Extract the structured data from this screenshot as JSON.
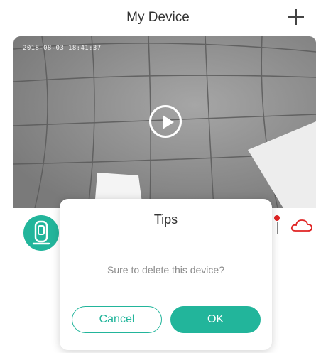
{
  "header": {
    "title": "My Device",
    "add_icon": "plus-icon"
  },
  "device": {
    "timestamp": "2018-08-03 18:41:37",
    "play_icon": "play-icon",
    "avatar_icon": "camera-device-icon",
    "cloud_icon": "cloud-icon",
    "alert_icon": "alert-icon"
  },
  "dialog": {
    "title": "Tips",
    "message": "Sure to delete this device?",
    "cancel_label": "Cancel",
    "ok_label": "OK"
  },
  "colors": {
    "accent": "#22b59b",
    "alert": "#e02424"
  }
}
